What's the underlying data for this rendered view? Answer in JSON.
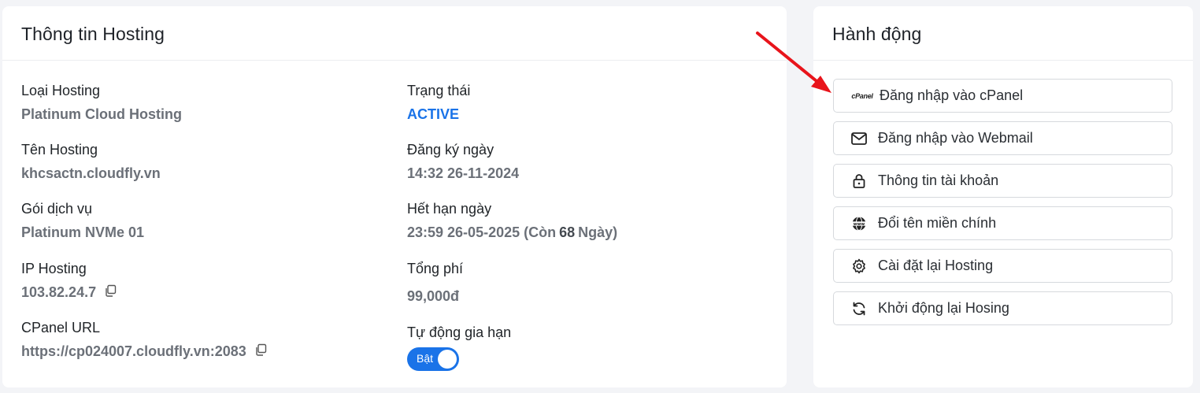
{
  "info": {
    "title": "Thông tin Hosting",
    "fields": {
      "type_label": "Loại Hosting",
      "type_value": "Platinum Cloud Hosting",
      "name_label": "Tên Hosting",
      "name_value": "khcsactn.cloudfly.vn",
      "package_label": "Gói dịch vụ",
      "package_value": "Platinum NVMe 01",
      "ip_label": "IP Hosting",
      "ip_value": "103.82.24.7",
      "cpanel_label": "CPanel URL",
      "cpanel_value": "https://cp024007.cloudfly.vn:2083",
      "status_label": "Trạng thái",
      "status_value": "ACTIVE",
      "registered_label": "Đăng ký ngày",
      "registered_value": "14:32 26-11-2024",
      "expiry_label": "Hết hạn ngày",
      "expiry_value_prefix": "23:59 26-05-2025 (Còn",
      "expiry_days": "68",
      "expiry_value_suffix": "Ngày)",
      "fee_label": "Tổng phí",
      "fee_value": "99,000đ",
      "autorenew_label": "Tự động gia hạn",
      "autorenew_toggle": "Bật"
    },
    "autorenew_on": true
  },
  "actions": {
    "title": "Hành động",
    "cpanel_logo_text": "cPanel",
    "buttons": [
      {
        "label": "Đăng nhập vào cPanel",
        "icon": "cpanel-logo-icon"
      },
      {
        "label": "Đăng nhập vào Webmail",
        "icon": "envelope-icon"
      },
      {
        "label": "Thông tin tài khoản",
        "icon": "lock-icon"
      },
      {
        "label": "Đổi tên miền chính",
        "icon": "globe-www-icon"
      },
      {
        "label": "Cài đặt lại Hosting",
        "icon": "gear-icon"
      },
      {
        "label": "Khởi động lại Hosing",
        "icon": "refresh-icon"
      }
    ]
  },
  "colors": {
    "accent": "#1a73e8",
    "arrow": "#e8141b"
  }
}
